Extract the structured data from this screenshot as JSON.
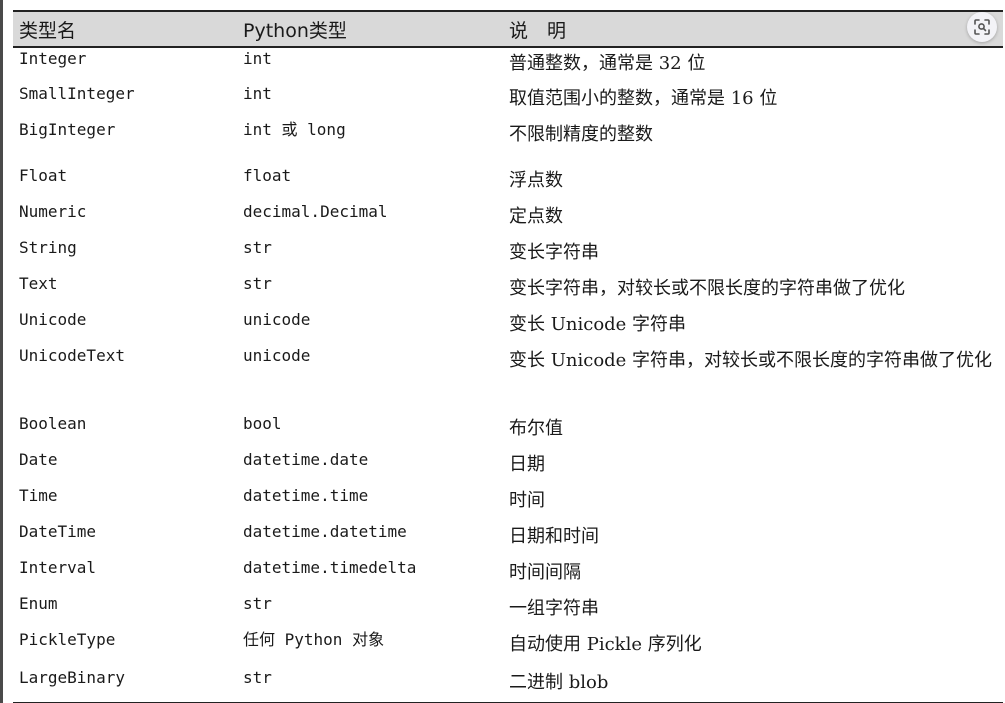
{
  "table": {
    "headers": [
      "类型名",
      "Python类型",
      "说　明"
    ],
    "rows": [
      {
        "name": "Integer",
        "python": "int",
        "desc": "普通整数，通常是 32 位"
      },
      {
        "name": "SmallInteger",
        "python": "int",
        "desc": "取值范围小的整数，通常是 16 位"
      },
      {
        "name": "BigInteger",
        "python": "int 或 long",
        "desc": "不限制精度的整数"
      },
      {
        "name": "Float",
        "python": "float",
        "desc": "浮点数"
      },
      {
        "name": "Numeric",
        "python": "decimal.Decimal",
        "desc": "定点数"
      },
      {
        "name": "String",
        "python": "str",
        "desc": "变长字符串"
      },
      {
        "name": "Text",
        "python": "str",
        "desc": "变长字符串，对较长或不限长度的字符串做了优化"
      },
      {
        "name": "Unicode",
        "python": "unicode",
        "desc": "变长 Unicode 字符串"
      },
      {
        "name": "UnicodeText",
        "python": "unicode",
        "desc": "变长 Unicode 字符串，对较长或不限长度的字符串做了优化"
      },
      {
        "name": "Boolean",
        "python": "bool",
        "desc": "布尔值"
      },
      {
        "name": "Date",
        "python": "datetime.date",
        "desc": "日期"
      },
      {
        "name": "Time",
        "python": "datetime.time",
        "desc": "时间"
      },
      {
        "name": "DateTime",
        "python": "datetime.datetime",
        "desc": "日期和时间"
      },
      {
        "name": "Interval",
        "python": "datetime.timedelta",
        "desc": "时间间隔"
      },
      {
        "name": "Enum",
        "python": "str",
        "desc": "一组字符串"
      },
      {
        "name": "PickleType",
        "python": "任何 Python 对象",
        "desc": "自动使用 Pickle 序列化"
      },
      {
        "name": "LargeBinary",
        "python": "str",
        "desc": "二进制 blob"
      }
    ]
  },
  "lens_button": {
    "icon": "lens-search-icon"
  }
}
